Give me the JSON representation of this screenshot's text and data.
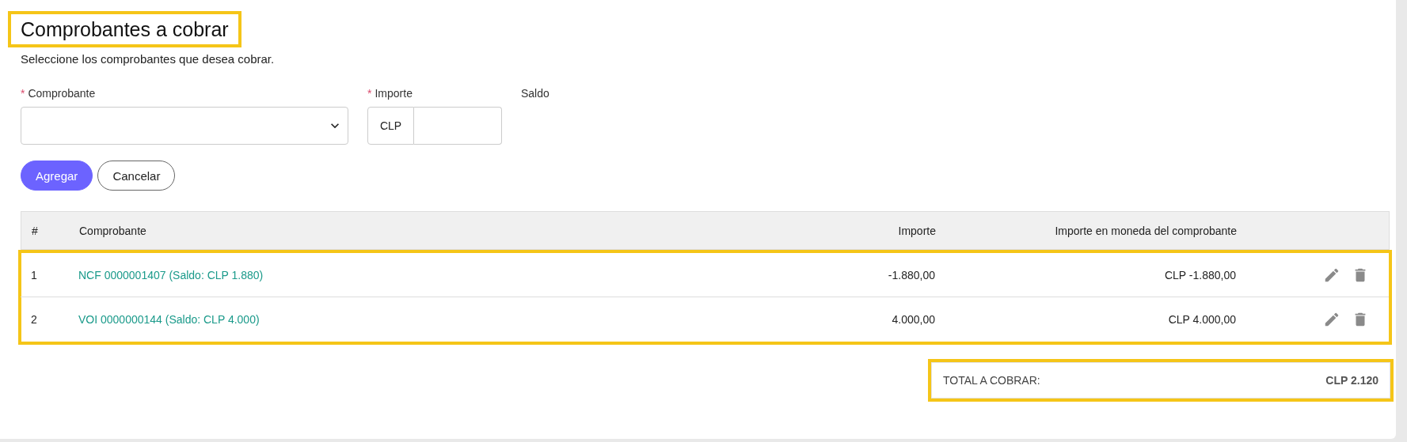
{
  "title": {
    "text": "Comprobantes a cobrar",
    "highlighted": true
  },
  "subtitle": "Seleccione los comprobantes que desea cobrar.",
  "form": {
    "fields": [
      {
        "kind": "select",
        "label": "Comprobante",
        "required_mark": "*"
      },
      {
        "kind": "amount",
        "label": "Importe",
        "required_mark": "*",
        "prefix": "CLP"
      },
      {
        "kind": "text",
        "label": "Saldo"
      }
    ],
    "buttons": [
      {
        "label": "Agregar",
        "primary": true
      },
      {
        "label": "Cancelar",
        "primary": false
      }
    ]
  },
  "table": {
    "columns": [
      "#",
      "Comprobante",
      "Importe",
      "Importe en moneda del comprobante"
    ],
    "rows_highlighted": true,
    "rows": [
      {
        "number": "1",
        "comprobante": "NCF 0000001407 (Saldo: CLP 1.880)",
        "importe": "-1.880,00",
        "importe_moneda": "CLP -1.880,00"
      },
      {
        "number": "2",
        "comprobante": "VOI 0000000144 (Saldo: CLP 4.000)",
        "importe": "4.000,00",
        "importe_moneda": "CLP 4.000,00"
      }
    ]
  },
  "total": {
    "label": "TOTAL A COBRAR:",
    "value": "CLP 2.120",
    "highlighted": true
  }
}
